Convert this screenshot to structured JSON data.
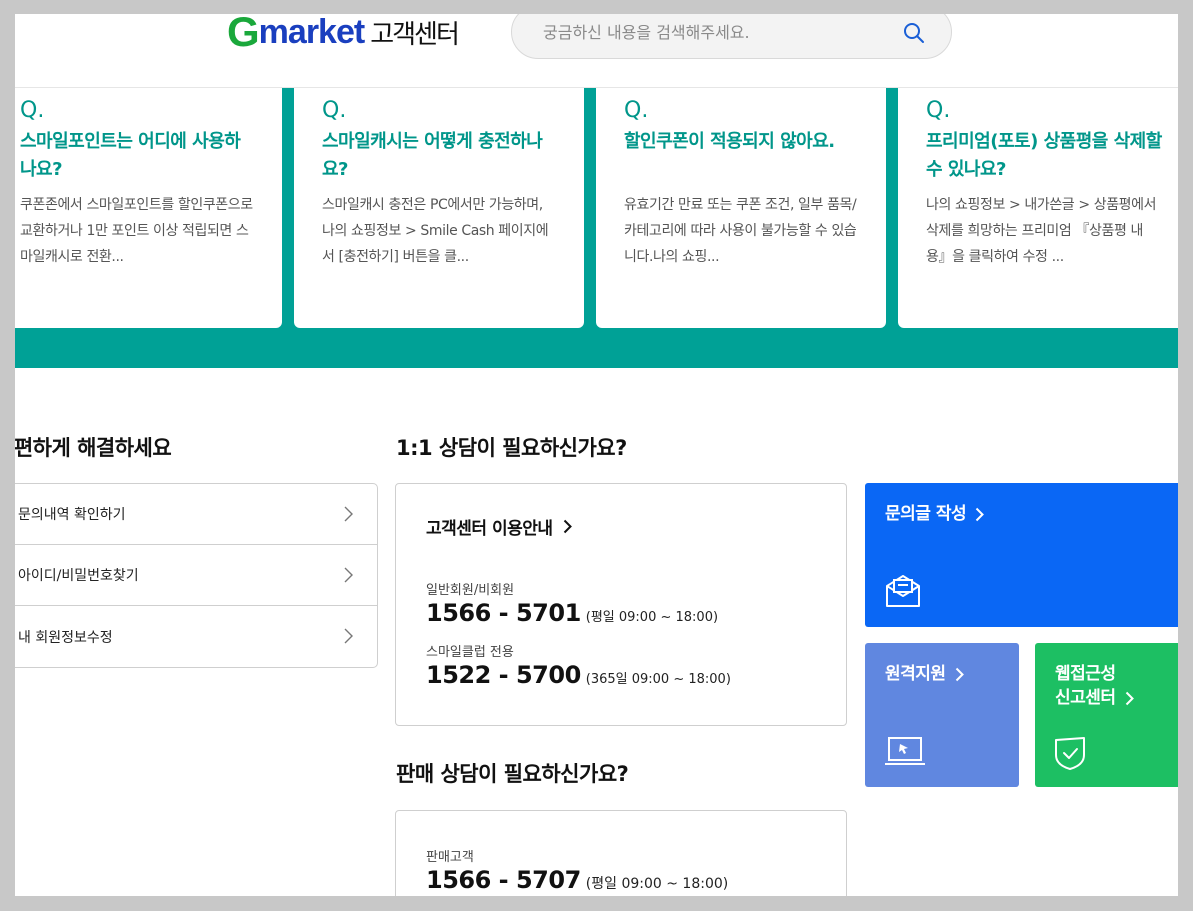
{
  "header": {
    "logo_g": "G",
    "logo_market": "market",
    "logo_cs": "고객센터",
    "search_placeholder": "궁금하신 내용을 검색해주세요."
  },
  "faq": [
    {
      "q": "Q.",
      "title": "스마일포인트는 어디에 사용하나요?",
      "body": "쿠폰존에서 스마일포인트를 할인쿠폰으로 교환하거나 1만 포인트 이상 적립되면 스마일캐시로 전환..."
    },
    {
      "q": "Q.",
      "title": "스마일캐시는 어떻게 충전하나요?",
      "body": "스마일캐시 충전은 PC에서만 가능하며, 나의 쇼핑정보 > Smile Cash 페이지에서 [충전하기] 버튼을 클..."
    },
    {
      "q": "Q.",
      "title": "할인쿠폰이 적용되지 않아요.",
      "body": "유효기간 만료 또는 쿠폰 조건, 일부 품목/카테고리에 따라 사용이 불가능할 수 있습니다.나의 쇼핑..."
    },
    {
      "q": "Q.",
      "title": "프리미엄(포토) 상품평을 삭제할 수 있나요?",
      "body": "나의 쇼핑정보 > 내가쓴글 > 상품평에서 삭제를 희망하는 프리미엄 『상품평 내용』을 클릭하여 수정 ..."
    }
  ],
  "self_service": {
    "title": "간편하게 해결하세요",
    "items": [
      {
        "label": "문의내역 확인하기"
      },
      {
        "label": "아이디/비밀번호찾기"
      },
      {
        "label": "내 회원정보수정"
      }
    ]
  },
  "consult": {
    "title": "1:1 상담이 필요하신가요?",
    "guide_label": "고객센터 이용안내",
    "lines": [
      {
        "label": "일반회원/비회원",
        "phone": "1566 - 5701",
        "hours": "(평일 09:00 ~ 18:00)"
      },
      {
        "label": "스마일클럽 전용",
        "phone": "1522 - 5700",
        "hours": "(365일 09:00 ~ 18:00)"
      }
    ]
  },
  "sales": {
    "title": "판매 상담이 필요하신가요?",
    "label": "판매고객",
    "phone": "1566 - 5707",
    "hours": "(평일 09:00 ~ 18:00)"
  },
  "tiles": {
    "inquiry": {
      "label": "문의글 작성",
      "color": "#0a67f5"
    },
    "remote": {
      "label": "원격지원",
      "color": "#6087e0"
    },
    "accessibility": {
      "label_line1": "웹접근성",
      "label_line2": "신고센터",
      "color": "#1dbf63"
    }
  },
  "colors": {
    "teal": "#00a196",
    "faq_text": "#00968a"
  }
}
